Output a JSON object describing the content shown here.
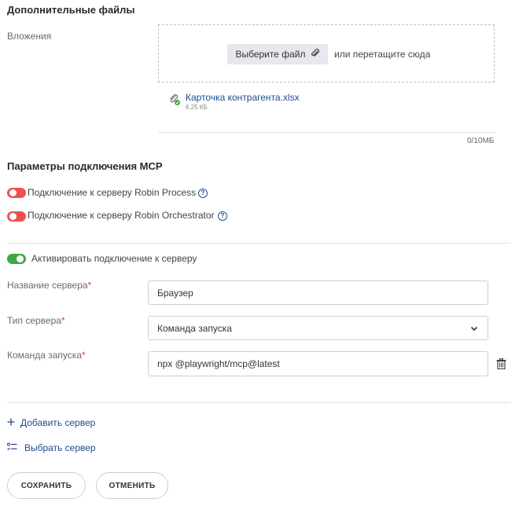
{
  "attachments": {
    "title": "Дополнительные файлы",
    "label": "Вложения",
    "choose_button": "Выберите файл",
    "drop_hint": "или перетащите сюда",
    "file": {
      "name": "Карточка контрагента.xlsx",
      "size": "6.25 КБ"
    },
    "counter": "0/10МБ"
  },
  "mcp": {
    "title": "Параметры подключения MCP",
    "toggles": [
      {
        "label": "Подключение к серверу Robin Process",
        "enabled": false
      },
      {
        "label": "Подключение к серверу Robin Orchestrator",
        "enabled": false
      }
    ],
    "server": {
      "activate_label": "Активировать подключение к серверу",
      "activate_enabled": true,
      "name_label": "Название сервера",
      "name_value": "Браузер",
      "type_label": "Тип сервера",
      "type_value": "Команда запуска",
      "command_label": "Команда запуска",
      "command_value": "npx @playwright/mcp@latest",
      "required_mark": "*"
    },
    "add_server": "Добавить сервер",
    "select_server": "Выбрать сервер"
  },
  "actions": {
    "save": "СОХРАНИТЬ",
    "cancel": "ОТМЕНИТЬ"
  },
  "colors": {
    "accent": "#1e4b8f",
    "toggle_off": "#ef4f50",
    "toggle_on": "#3aa845",
    "required": "#e53935"
  }
}
